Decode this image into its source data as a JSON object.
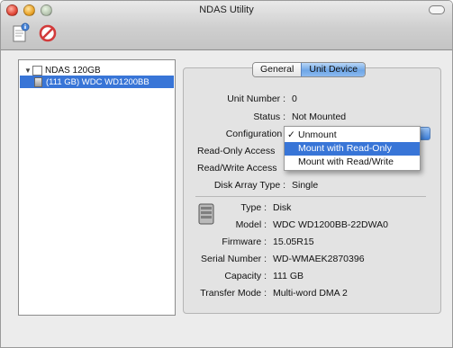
{
  "window": {
    "title": "NDAS Utility"
  },
  "toolbar": {
    "info_icon": "info-document-icon",
    "stop_icon": "unregister-icon"
  },
  "tree": {
    "device": "NDAS 120GB",
    "unit": "(111 GB) WDC WD1200BB"
  },
  "tabs": [
    {
      "label": "General"
    },
    {
      "label": "Unit Device"
    }
  ],
  "unit": {
    "unit_number_label": "Unit Number :",
    "unit_number": "0",
    "status_label": "Status :",
    "status": "Not Mounted",
    "configuration_label": "Configuration :",
    "read_only_label": "Read-Only Access",
    "read_write_label": "Read/Write Access",
    "disk_array_label": "Disk Array Type :",
    "disk_array": "Single"
  },
  "menu": {
    "items": [
      {
        "label": "Unmount",
        "checked": true
      },
      {
        "label": "Mount with Read-Only",
        "highlighted": true
      },
      {
        "label": "Mount with Read/Write"
      }
    ]
  },
  "details": {
    "type_label": "Type :",
    "type": "Disk",
    "model_label": "Model :",
    "model": "WDC WD1200BB-22DWA0",
    "firmware_label": "Firmware :",
    "firmware": "15.05R15",
    "serial_label": "Serial Number :",
    "serial": "WD-WMAEK2870396",
    "capacity_label": "Capacity :",
    "capacity": "111 GB",
    "transfer_label": "Transfer Mode :",
    "transfer": "Multi-word DMA 2"
  },
  "colors": {
    "selection": "#3875d7",
    "tab_active": "#6fa6e6"
  }
}
